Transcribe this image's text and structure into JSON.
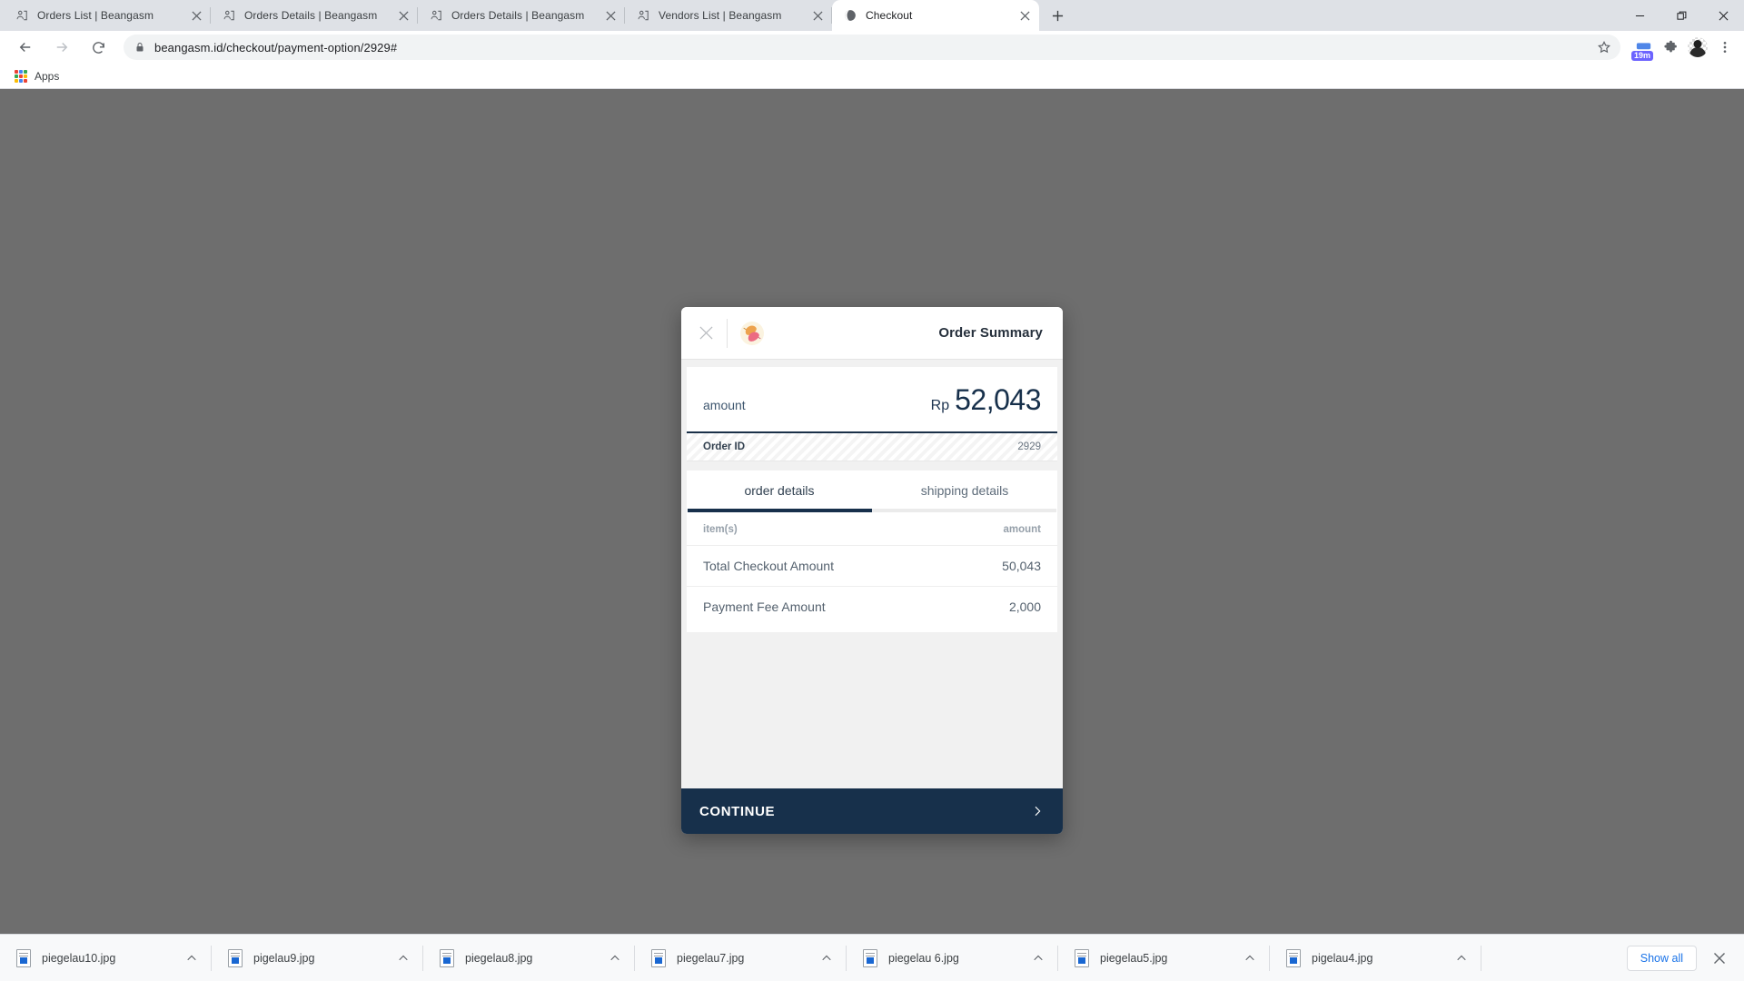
{
  "window": {
    "controls": [
      {
        "name": "minimize-button",
        "glyph": "minimize-icon"
      },
      {
        "name": "maximize-button",
        "glyph": "maximize-icon"
      },
      {
        "name": "close-window-button",
        "glyph": "close-icon"
      }
    ]
  },
  "tabs": [
    {
      "title": "Orders List | Beangasm",
      "favicon": "person-page-icon",
      "active": false
    },
    {
      "title": "Orders Details | Beangasm",
      "favicon": "person-page-icon",
      "active": false
    },
    {
      "title": "Orders Details | Beangasm",
      "favicon": "person-page-icon",
      "active": false
    },
    {
      "title": "Vendors List | Beangasm",
      "favicon": "person-page-icon",
      "active": false
    },
    {
      "title": "Checkout",
      "favicon": "globe-icon",
      "active": true
    }
  ],
  "newtab_label": "+",
  "toolbar": {
    "back_icon": "back-arrow-icon",
    "forward_icon": "forward-arrow-icon",
    "reload_icon": "reload-icon",
    "lock_icon": "lock-icon",
    "url_domain": "beangasm.id",
    "url_path": "/checkout/payment-option/2929#",
    "url_full": "beangasm.id/checkout/payment-option/2929#",
    "star_icon": "bookmark-star-icon",
    "extension_badge": "19m",
    "extensions_icon": "puzzle-piece-icon",
    "profile_icon": "avatar-icon",
    "menu_icon": "three-dot-menu-icon"
  },
  "bookmarks": {
    "apps_label": "Apps"
  },
  "modal": {
    "close_icon": "close-icon",
    "brand_logo": "beangasm-beans-logo",
    "title": "Order Summary",
    "amount": {
      "label": "amount",
      "currency": "Rp",
      "value": "52,043"
    },
    "order_id": {
      "label": "Order ID",
      "value": "2929"
    },
    "tabs": [
      {
        "label": "order details",
        "active": true
      },
      {
        "label": "shipping details",
        "active": false
      }
    ],
    "table": {
      "headers": {
        "left": "item(s)",
        "right": "amount"
      },
      "rows": [
        {
          "item": "Total Checkout Amount",
          "amount": "50,043"
        },
        {
          "item": "Payment Fee Amount",
          "amount": "2,000"
        }
      ]
    },
    "continue": {
      "label": "CONTINUE",
      "arrow_icon": "chevron-right-icon"
    }
  },
  "downloads": {
    "items": [
      {
        "filename": "piegelau10.jpg"
      },
      {
        "filename": "pigelau9.jpg"
      },
      {
        "filename": "piegelau8.jpg"
      },
      {
        "filename": "piegelau7.jpg"
      },
      {
        "filename": "piegelau 6.jpg"
      },
      {
        "filename": "piegelau5.jpg"
      },
      {
        "filename": "pigelau4.jpg"
      }
    ],
    "show_all_label": "Show all",
    "close_icon": "close-icon",
    "caret_icon": "chevron-up-icon"
  },
  "colors": {
    "accent_dark": "#17304b",
    "page_backdrop": "#6e6e6e",
    "link_blue": "#1a73e8",
    "ext_badge": "#6c63ff"
  }
}
